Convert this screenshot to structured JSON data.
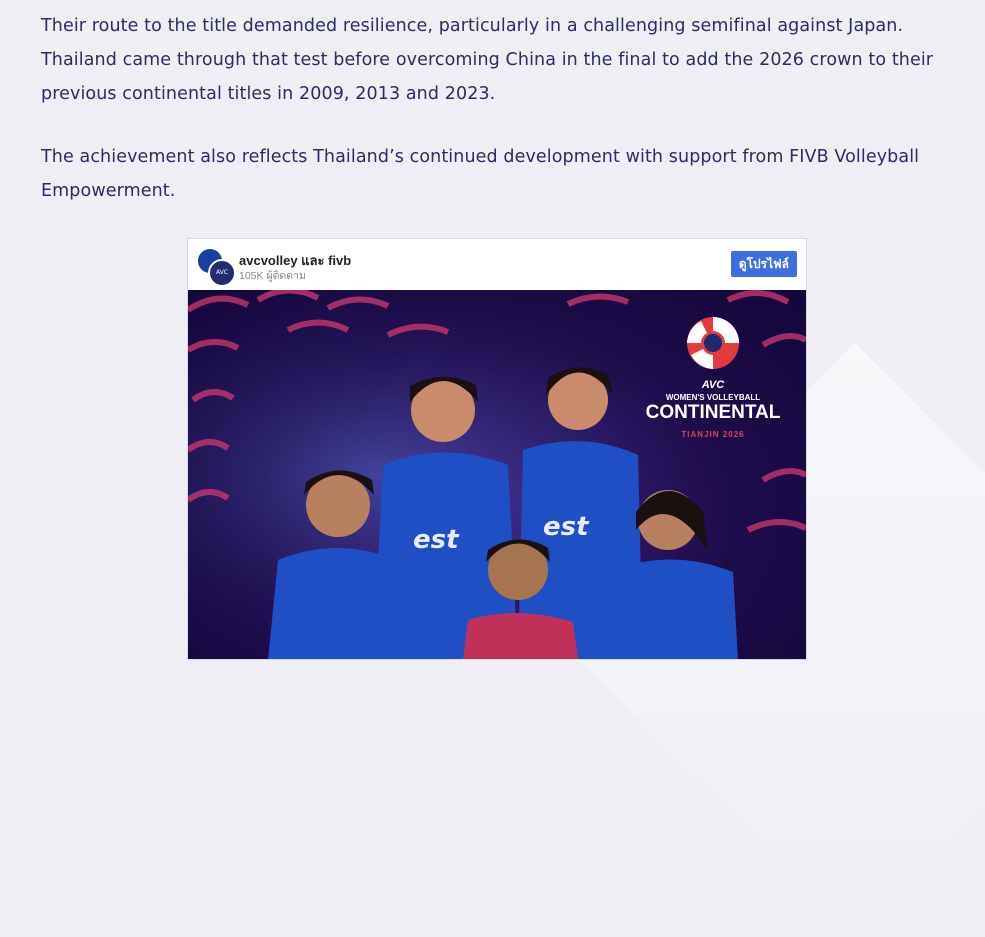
{
  "article": {
    "paragraph_1": "Their route to the title demanded resilience, particularly in a challenging semifinal against Japan. Thailand came through that test before overcoming China in the final to add the 2026 crown to their previous continental titles in 2009, 2013 and 2023.",
    "paragraph_2": "The achievement also reflects Thailand’s continued development with support from FIVB Volleyball Empowerment."
  },
  "embed": {
    "account_name": "avcvolley และ fivb",
    "followers": "105K ผู้ติดตาม",
    "profile_button": "ดูโปรไฟล์",
    "avatar_text": "AVC",
    "image": {
      "logo_avc": "AVC",
      "logo_subtitle": "WOMEN'S VOLLEYBALL",
      "logo_title": "CONTINENTAL",
      "logo_city": "TIANJIN 2026"
    }
  },
  "colors": {
    "text": "#2b2b66",
    "button": "#3f6ee0",
    "poster_bg": "#1d0c4a",
    "jersey": "#1f4fc4",
    "accent_red": "#e0405a"
  }
}
